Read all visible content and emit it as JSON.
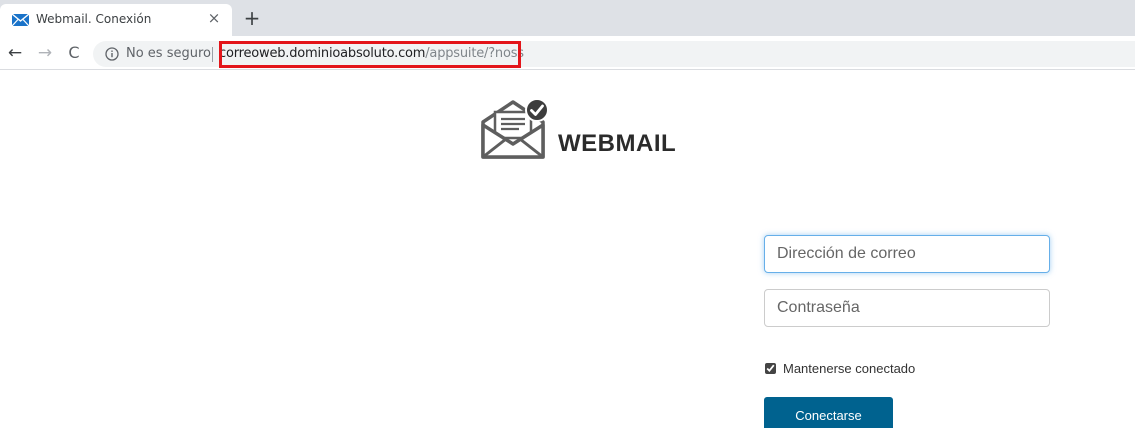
{
  "browser": {
    "tab_title": "Webmail. Conexión",
    "tab_close": "×",
    "new_tab": "+",
    "back": "←",
    "forward": "→",
    "reload": "C",
    "security_text": "No es seguro",
    "url_host": "correoweb.dominioabsoluto.com",
    "url_path": "/appsuite/?noss",
    "highlight_color": "#e3151a"
  },
  "logo": {
    "text": "WEBMAIL"
  },
  "login": {
    "email_placeholder": "Dirección de correo",
    "password_placeholder": "Contraseña",
    "remember_label": "Mantenerse conectado",
    "remember_checked": true,
    "submit_label": "Conectarse",
    "accent_color": "#00628f"
  }
}
